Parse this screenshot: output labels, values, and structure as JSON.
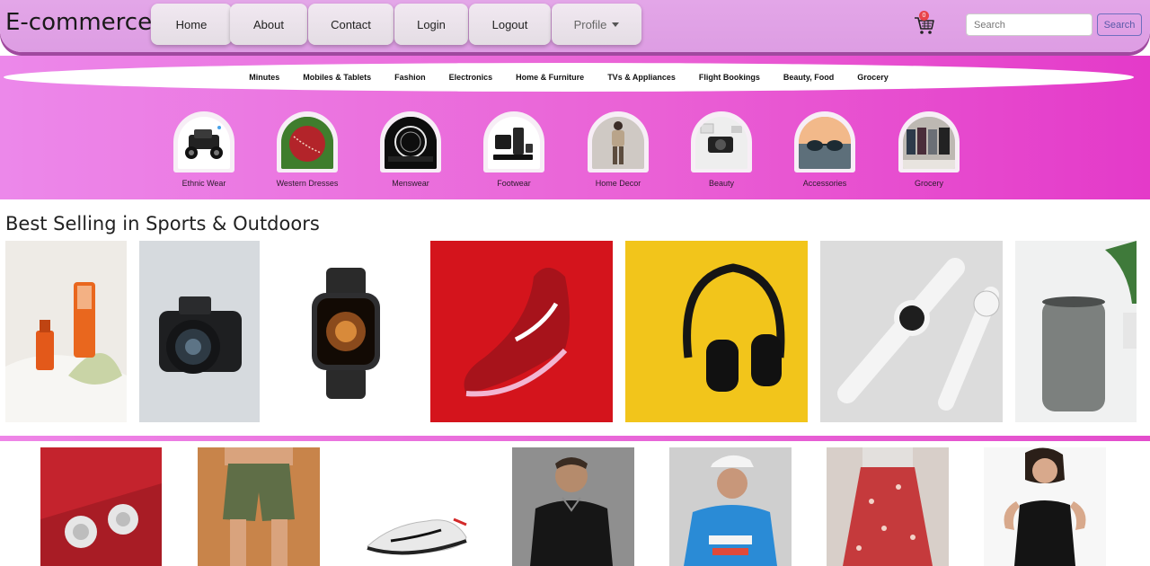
{
  "navbar": {
    "brand": "E-commerce",
    "links": [
      "Home",
      "About",
      "Contact",
      "Login",
      "Logout"
    ],
    "profile_label": "Profile",
    "cart_count": "0",
    "search": {
      "placeholder": "Search",
      "button_label": "Search"
    }
  },
  "category_bar": [
    "Minutes",
    "Mobiles & Tablets",
    "Fashion",
    "Electronics",
    "Home & Furniture",
    "TVs & Appliances",
    "Flight Bookings",
    "Beauty, Food",
    "Grocery"
  ],
  "circle_categories": [
    {
      "label": "Ethnic Wear",
      "icon": "rc-car-icon"
    },
    {
      "label": "Western Dresses",
      "icon": "cricket-ball-icon"
    },
    {
      "label": "Menswear",
      "icon": "cooktop-icon"
    },
    {
      "label": "Footwear",
      "icon": "speaker-system-icon"
    },
    {
      "label": "Home Decor",
      "icon": "fashion-model-icon"
    },
    {
      "label": "Beauty",
      "icon": "camera-gear-icon"
    },
    {
      "label": "Accessories",
      "icon": "sunglasses-icon"
    },
    {
      "label": "Grocery",
      "icon": "clothing-store-icon"
    }
  ],
  "section": {
    "title": "Best Selling in Sports & Outdoors"
  },
  "products_row1": [
    "skincare-bottles-image",
    "dslr-camera-image",
    "smartwatch-image",
    "red-sneaker-image",
    "headphones-image",
    "white-watch-image",
    "smart-speaker-image"
  ],
  "products_row2": [
    "earrings-image",
    "green-shorts-image",
    "running-shoe-image",
    "polo-shirt-image",
    "cricket-jersey-image",
    "floral-skirt-image",
    "black-top-image"
  ],
  "colors": {
    "accent_pink": "#e43ac9",
    "nav_lilac": "#e3a6e8",
    "search_border": "#6f6fbf"
  }
}
